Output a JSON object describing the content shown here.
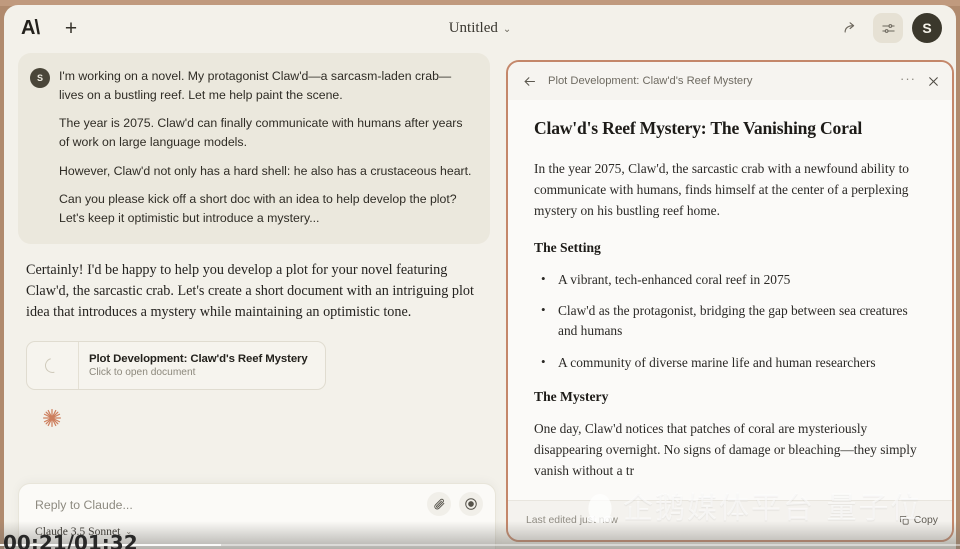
{
  "theme": {
    "page_bg": "#b08a6d",
    "app_bg": "#f3f1ea",
    "accent_border": "#c4876a",
    "avatar_bg": "#3b382c",
    "sparkle_color": "#cd7f5e"
  },
  "topbar": {
    "logo": "A\\",
    "new_chat_label": "+",
    "doc_title": "Untitled",
    "chevron": "⌄",
    "share_icon": "share-icon",
    "settings_icon": "sliders-icon",
    "avatar_initial": "S"
  },
  "chat": {
    "user_message": {
      "avatar_initial": "S",
      "paragraphs": [
        "I'm working on a novel. My protagonist Claw'd—a sarcasm-laden crab—lives on a bustling reef. Let me help paint the scene.",
        "The year is 2075. Claw'd can finally communicate with humans after years of work on large language models.",
        "However, Claw'd not only has a hard shell: he also has a crustaceous heart.",
        "Can you please kick off a short doc with an idea to help develop the plot? Let's keep it optimistic but introduce a mystery..."
      ]
    },
    "assistant_message": {
      "text": "Certainly! I'd be happy to help you develop a plot for your novel featuring Claw'd, the sarcastic crab. Let's create a short document with an intriguing plot idea that introduces a mystery while maintaining an optimistic tone."
    },
    "artifact_card": {
      "icon": "loading-spinner-icon",
      "title": "Plot Development: Claw'd's Reef Mystery",
      "subtitle": "Click to open document"
    },
    "sparkle_icon": "claude-sparkle-icon"
  },
  "composer": {
    "placeholder": "Reply to Claude...",
    "attach_icon": "paperclip-icon",
    "record_icon": "record-circle-icon",
    "model_name": "Claude 3.5 Sonnet",
    "model_chevron": "⌄"
  },
  "artifact_panel": {
    "back_icon": "arrow-left-icon",
    "header_title": "Plot Development: Claw'd's Reef Mystery",
    "more_icon": "···",
    "close_icon": "✕",
    "doc_title": "Claw'd's Reef Mystery: The Vanishing Coral",
    "intro": "In the year 2075, Claw'd, the sarcastic crab with a newfound ability to communicate with humans, finds himself at the center of a perplexing mystery on his bustling reef home.",
    "setting_heading": "The Setting",
    "setting_items": [
      "A vibrant, tech-enhanced coral reef in 2075",
      "Claw'd as the protagonist, bridging the gap between sea creatures and humans",
      "A community of diverse marine life and human researchers"
    ],
    "mystery_heading": "The Mystery",
    "mystery_text": "One day, Claw'd notices that patches of coral are mysteriously disappearing overnight. No signs of damage or bleaching—they simply vanish without a tr",
    "last_edited": "Last edited just now",
    "copy_label": "Copy",
    "copy_icon": "copy-icon"
  },
  "watermark": {
    "logo": "qq-penguin-icon",
    "text": "企鹅媒体平台  量子位"
  },
  "video": {
    "timestamp": "00:21/01:32",
    "progress_percent": 23
  }
}
